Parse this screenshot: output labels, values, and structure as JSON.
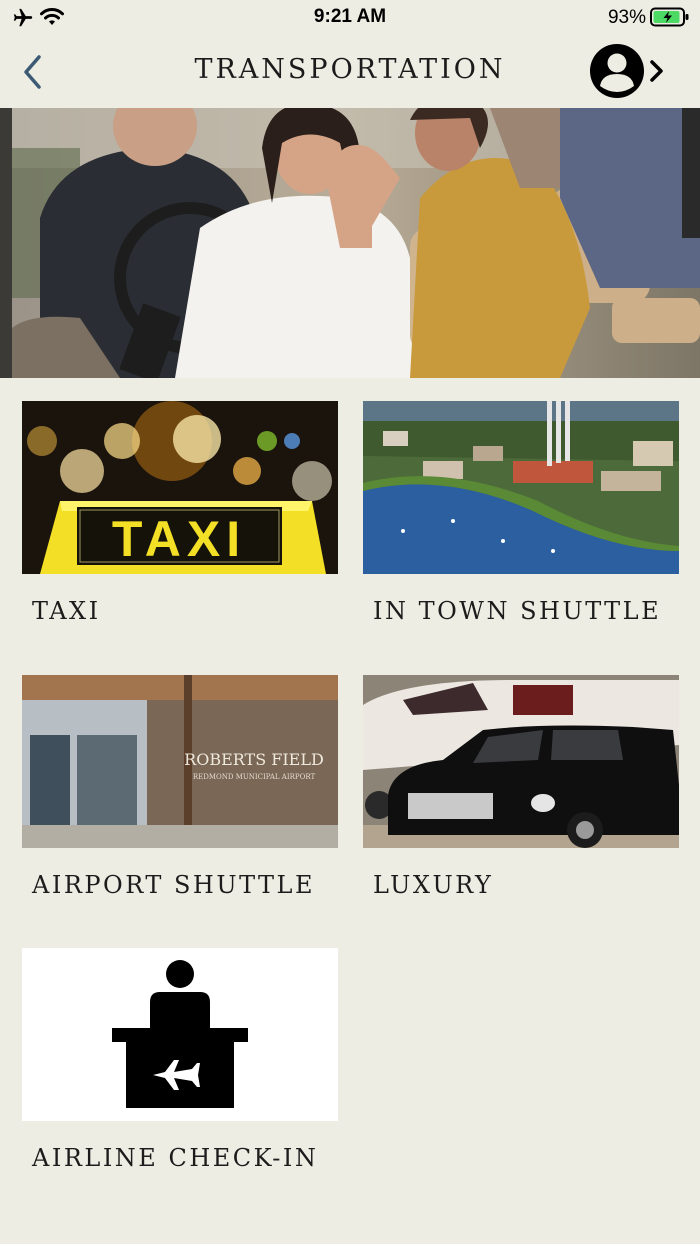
{
  "status_bar": {
    "time": "9:21 AM",
    "battery_percent": "93%",
    "battery_level": 0.93,
    "icons": [
      "airplane-icon",
      "wifi-icon",
      "battery-icon"
    ]
  },
  "header": {
    "title": "TRANSPORTATION",
    "back_icon": "chevron-left-icon",
    "profile_icon": "user-icon"
  },
  "colors": {
    "background": "#eeede3",
    "accent": "#3d5a75",
    "battery_green": "#4cd964"
  },
  "options": [
    {
      "label": "TAXI",
      "image": "taxi-sign-photo"
    },
    {
      "label": "IN TOWN SHUTTLE",
      "image": "town-aerial-photo"
    },
    {
      "label": "AIRPORT SHUTTLE",
      "image": "airport-terminal-photo"
    },
    {
      "label": "LUXURY",
      "image": "limousine-jet-photo"
    },
    {
      "label": "AIRLINE CHECK-IN",
      "image": "check-in-desk-icon"
    }
  ],
  "airport_sign": {
    "line1": "ROBERTS FIELD",
    "line2": "REDMOND MUNICIPAL AIRPORT"
  }
}
